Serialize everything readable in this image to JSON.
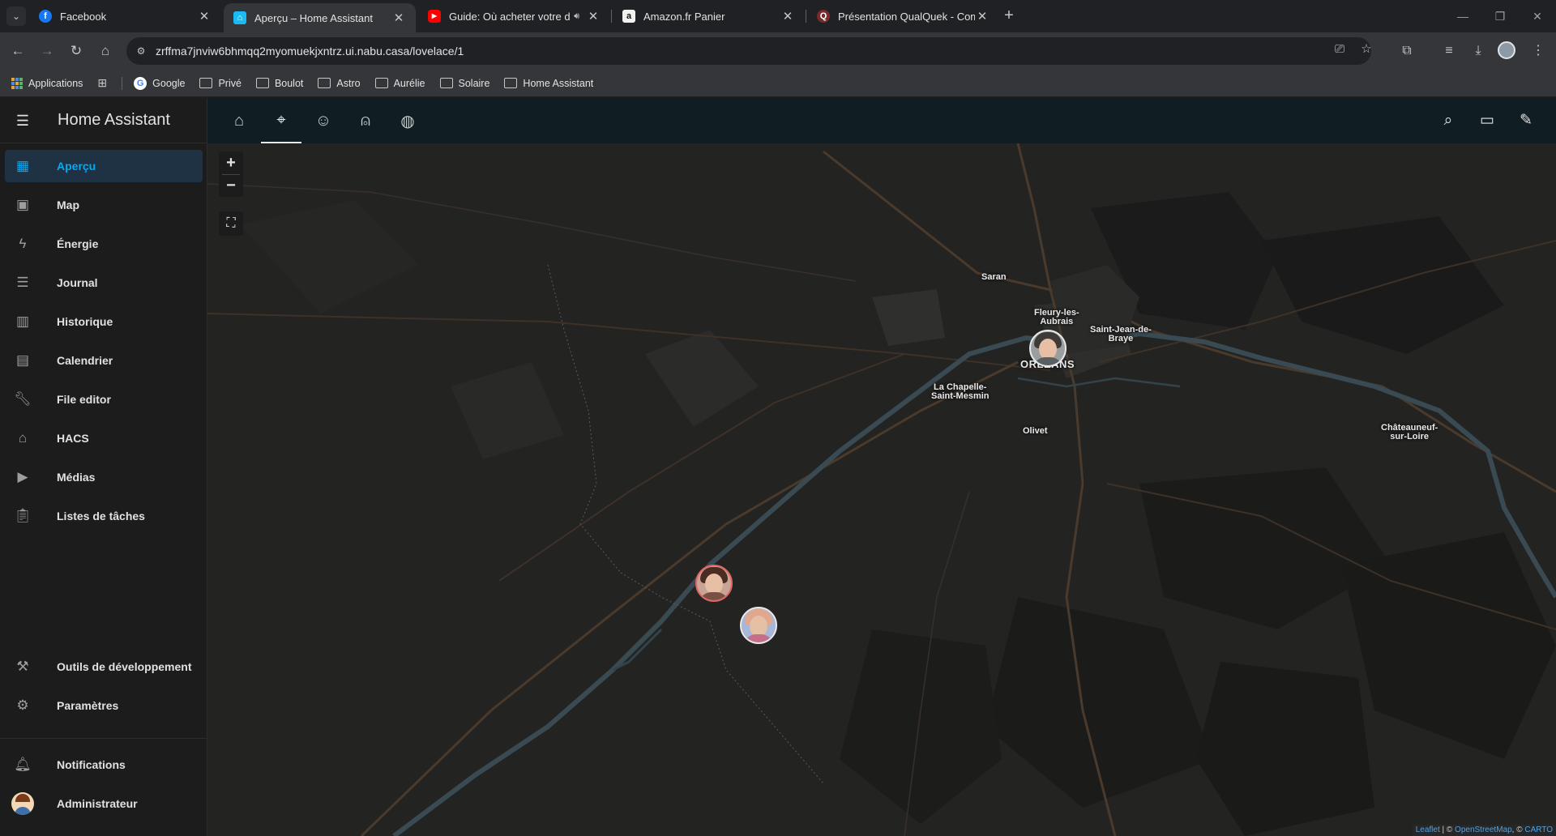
{
  "browser": {
    "tabs": [
      {
        "title": "Facebook",
        "favicon": "facebook-icon",
        "color": "#1877f2",
        "active": false
      },
      {
        "title": "Aperçu – Home Assistant",
        "favicon": "home-assistant-icon",
        "color": "#18bcf2",
        "active": true
      },
      {
        "title": "Guide: Où acheter votre do",
        "favicon": "youtube-icon",
        "color": "#ff0000",
        "active": false,
        "audio": true
      },
      {
        "title": "Amazon.fr Panier",
        "favicon": "amazon-icon",
        "color": "#f2f2f2",
        "active": false
      },
      {
        "title": "Présentation QualQuek - Comm",
        "favicon": "forum-icon",
        "color": "#7a2a2a",
        "active": false
      }
    ],
    "url": "zrffma7jnviw6bhmqq2myomuekjxntrz.ui.nabu.casa/lovelace/1",
    "bookmarks": [
      {
        "label": "Applications",
        "icon": "apps-icon"
      },
      {
        "label": "Google",
        "icon": "google-icon"
      },
      {
        "label": "Privé",
        "icon": "folder-icon"
      },
      {
        "label": "Boulot",
        "icon": "folder-icon"
      },
      {
        "label": "Astro",
        "icon": "folder-icon"
      },
      {
        "label": "Aurélie",
        "icon": "folder-icon"
      },
      {
        "label": "Solaire",
        "icon": "folder-icon"
      },
      {
        "label": "Home Assistant",
        "icon": "folder-icon"
      }
    ]
  },
  "sidebar": {
    "title": "Home Assistant",
    "items": [
      {
        "label": "Aperçu",
        "icon": "dashboard-icon",
        "active": true
      },
      {
        "label": "Map",
        "icon": "map-icon"
      },
      {
        "label": "Énergie",
        "icon": "lightning-icon"
      },
      {
        "label": "Journal",
        "icon": "list-icon"
      },
      {
        "label": "Historique",
        "icon": "chart-icon"
      },
      {
        "label": "Calendrier",
        "icon": "calendar-icon"
      },
      {
        "label": "File editor",
        "icon": "wrench-icon"
      },
      {
        "label": "HACS",
        "icon": "hacs-icon"
      },
      {
        "label": "Médias",
        "icon": "media-icon"
      },
      {
        "label": "Listes de tâches",
        "icon": "clipboard-icon"
      }
    ],
    "bottom_items": [
      {
        "label": "Outils de développement",
        "icon": "hammer-icon"
      },
      {
        "label": "Paramètres",
        "icon": "gear-icon"
      }
    ],
    "notifications_label": "Notifications",
    "user_label": "Administrateur"
  },
  "header": {
    "view_tabs": [
      {
        "icon": "home-icon",
        "active": false
      },
      {
        "icon": "map-marker-icon",
        "active": true
      },
      {
        "icon": "account-icon",
        "active": false
      },
      {
        "icon": "robot-vacuum-icon",
        "active": false
      },
      {
        "icon": "globe-icon",
        "active": false
      }
    ],
    "actions": [
      "search-icon",
      "assist-icon",
      "pencil-icon"
    ]
  },
  "map": {
    "zoom_in": "+",
    "zoom_out": "−",
    "places": {
      "saran": "Saran",
      "fleury": "Fleury-les-\nAubrais",
      "saint_jean": "Saint-Jean-de-\nBraye",
      "orleans": "ORLÉANS",
      "la_chapelle": "La Chapelle-\nSaint-Mesmin",
      "olivet": "Olivet",
      "chateauneuf": "Châteauneuf-\nsur-Loire"
    },
    "attribution": {
      "leaflet": "Leaflet",
      "sep1": " | © ",
      "osm": "OpenStreetMap",
      "sep2": ", © ",
      "carto": "CARTO"
    }
  }
}
